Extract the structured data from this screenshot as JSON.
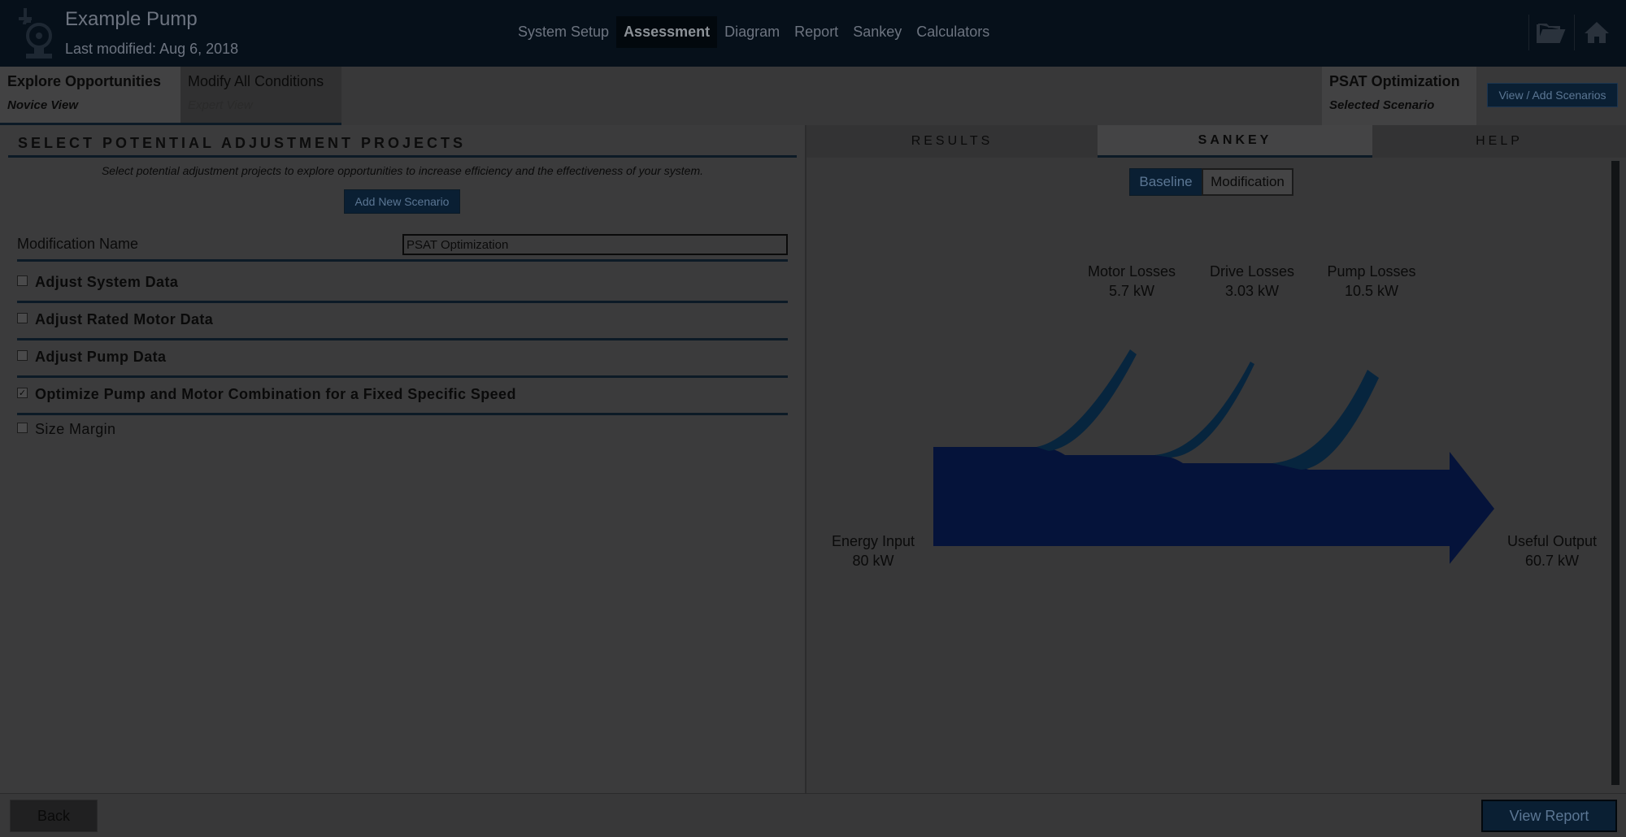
{
  "header": {
    "title": "Example Pump",
    "last_modified": "Last modified: Aug 6, 2018",
    "nav": [
      "System Setup",
      "Assessment",
      "Diagram",
      "Report",
      "Sankey",
      "Calculators"
    ],
    "active_nav": "Assessment",
    "icons": [
      "pump-logo-icon",
      "folder-open-icon",
      "home-icon"
    ]
  },
  "subbar": {
    "novice_title": "Explore Opportunities",
    "novice_sub": "Novice View",
    "expert_title": "Modify All Conditions",
    "expert_sub": "Expert View",
    "scenario_title": "PSAT Optimization",
    "scenario_sub": "Selected Scenario",
    "scenarios_button": "View / Add Scenarios"
  },
  "left": {
    "heading": "SELECT POTENTIAL ADJUSTMENT PROJECTS",
    "description": "Select potential adjustment projects to explore opportunities to increase efficiency and the effectiveness of your system.",
    "add_button": "Add New Scenario",
    "mod_name_label": "Modification Name",
    "mod_name_value": "PSAT Optimization",
    "options": [
      {
        "label": "Adjust System Data",
        "checked": false
      },
      {
        "label": "Adjust Rated Motor Data",
        "checked": false
      },
      {
        "label": "Adjust Pump Data",
        "checked": false
      },
      {
        "label": "Optimize Pump and Motor Combination for a Fixed Specific Speed",
        "checked": true
      },
      {
        "label": "Size Margin",
        "checked": false
      }
    ]
  },
  "right": {
    "tabs": [
      "RESULTS",
      "SANKEY",
      "HELP"
    ],
    "active_tab": "SANKEY",
    "toggle": [
      "Baseline",
      "Modification"
    ],
    "active_toggle": "Baseline",
    "sankey": {
      "input_label": "Energy Input",
      "input_value": "80 kW",
      "output_label": "Useful Output",
      "output_value": "60.7 kW",
      "losses": [
        {
          "label": "Motor Losses",
          "value": "5.7 kW"
        },
        {
          "label": "Drive Losses",
          "value": "3.03 kW"
        },
        {
          "label": "Pump Losses",
          "value": "10.5 kW"
        }
      ]
    }
  },
  "footer": {
    "back": "Back",
    "view_report": "View Report"
  }
}
